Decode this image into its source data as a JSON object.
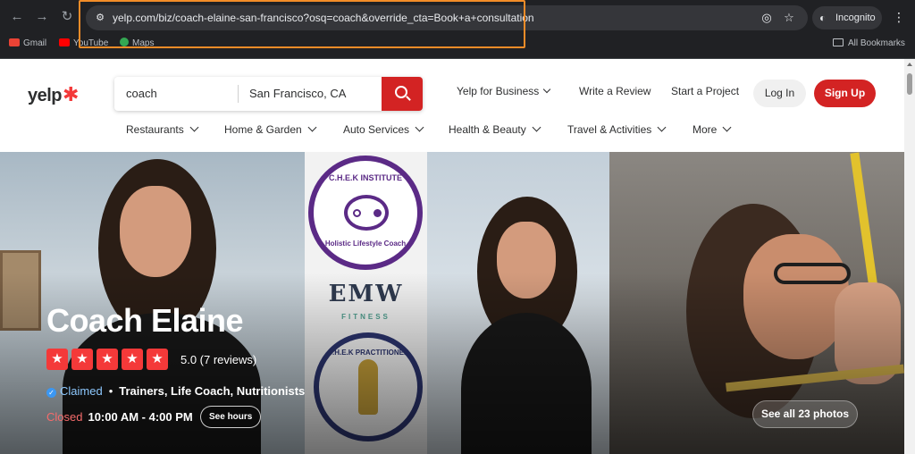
{
  "browser": {
    "url": "yelp.com/biz/coach-elaine-san-francisco?osq=coach&override_cta=Book+a+consultation",
    "incognito_label": "Incognito",
    "bookmarks": [
      {
        "label": "Gmail",
        "color": "#ea4335"
      },
      {
        "label": "YouTube",
        "color": "#ff0000"
      },
      {
        "label": "Maps",
        "color": "#34a853"
      }
    ],
    "all_bookmarks_label": "All Bookmarks"
  },
  "header": {
    "logo": "yelp",
    "search": {
      "term": "coach",
      "location": "San Francisco, CA"
    },
    "links": {
      "yelp_for_business": "Yelp for Business",
      "write_review": "Write a Review",
      "start_project": "Start a Project"
    },
    "login_label": "Log In",
    "signup_label": "Sign Up",
    "categories": [
      "Restaurants",
      "Home & Garden",
      "Auto Services",
      "Health & Beauty",
      "Travel & Activities",
      "More"
    ]
  },
  "photos": {
    "logo_texts": {
      "chek_top": "C.H.E.K INSTITUTE",
      "chek_bottom": "Holistic Lifestyle Coach",
      "emw": "EMW",
      "emw_sub": "FITNESS",
      "chek_practitioner": "C.H.E.K PRACTITIONER"
    },
    "see_all_label": "See all 23 photos"
  },
  "business": {
    "name": "Coach Elaine",
    "rating": 5,
    "rating_text": "5.0 (7 reviews)",
    "claimed_label": "Claimed",
    "categories_text": "Trainers, Life Coach, Nutritionists",
    "status": "Closed",
    "hours": "10:00 AM - 4:00 PM",
    "see_hours_label": "See hours"
  },
  "colors": {
    "yelp_red": "#d32323",
    "star_red": "#f43939",
    "url_highlight": "#f28c28"
  }
}
